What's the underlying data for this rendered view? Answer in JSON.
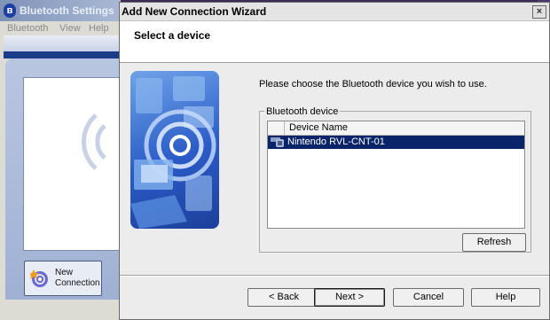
{
  "back_window": {
    "title": "Bluetooth Settings",
    "menu": [
      "Bluetooth",
      "View",
      "Help"
    ],
    "new_connection_label": "New\nConnection",
    "new_connection_line1": "New",
    "new_connection_line2": "Connection"
  },
  "dialog": {
    "title": "Add New Connection Wizard",
    "close_glyph": "×",
    "header": "Select a device",
    "instruction": "Please choose the Bluetooth device you wish to use.",
    "group_label": "Bluetooth device",
    "list": {
      "columns": [
        "",
        "Device Name"
      ],
      "rows": [
        {
          "name": "Nintendo RVL-CNT-01",
          "icon": "bluetooth-device-icon",
          "selected": true
        }
      ]
    },
    "buttons": {
      "refresh": "Refresh",
      "back": "< Back",
      "next": "Next >",
      "cancel": "Cancel",
      "help": "Help"
    }
  },
  "colors": {
    "selection": "#0a246a",
    "art_blue": "#2a5bc7"
  }
}
